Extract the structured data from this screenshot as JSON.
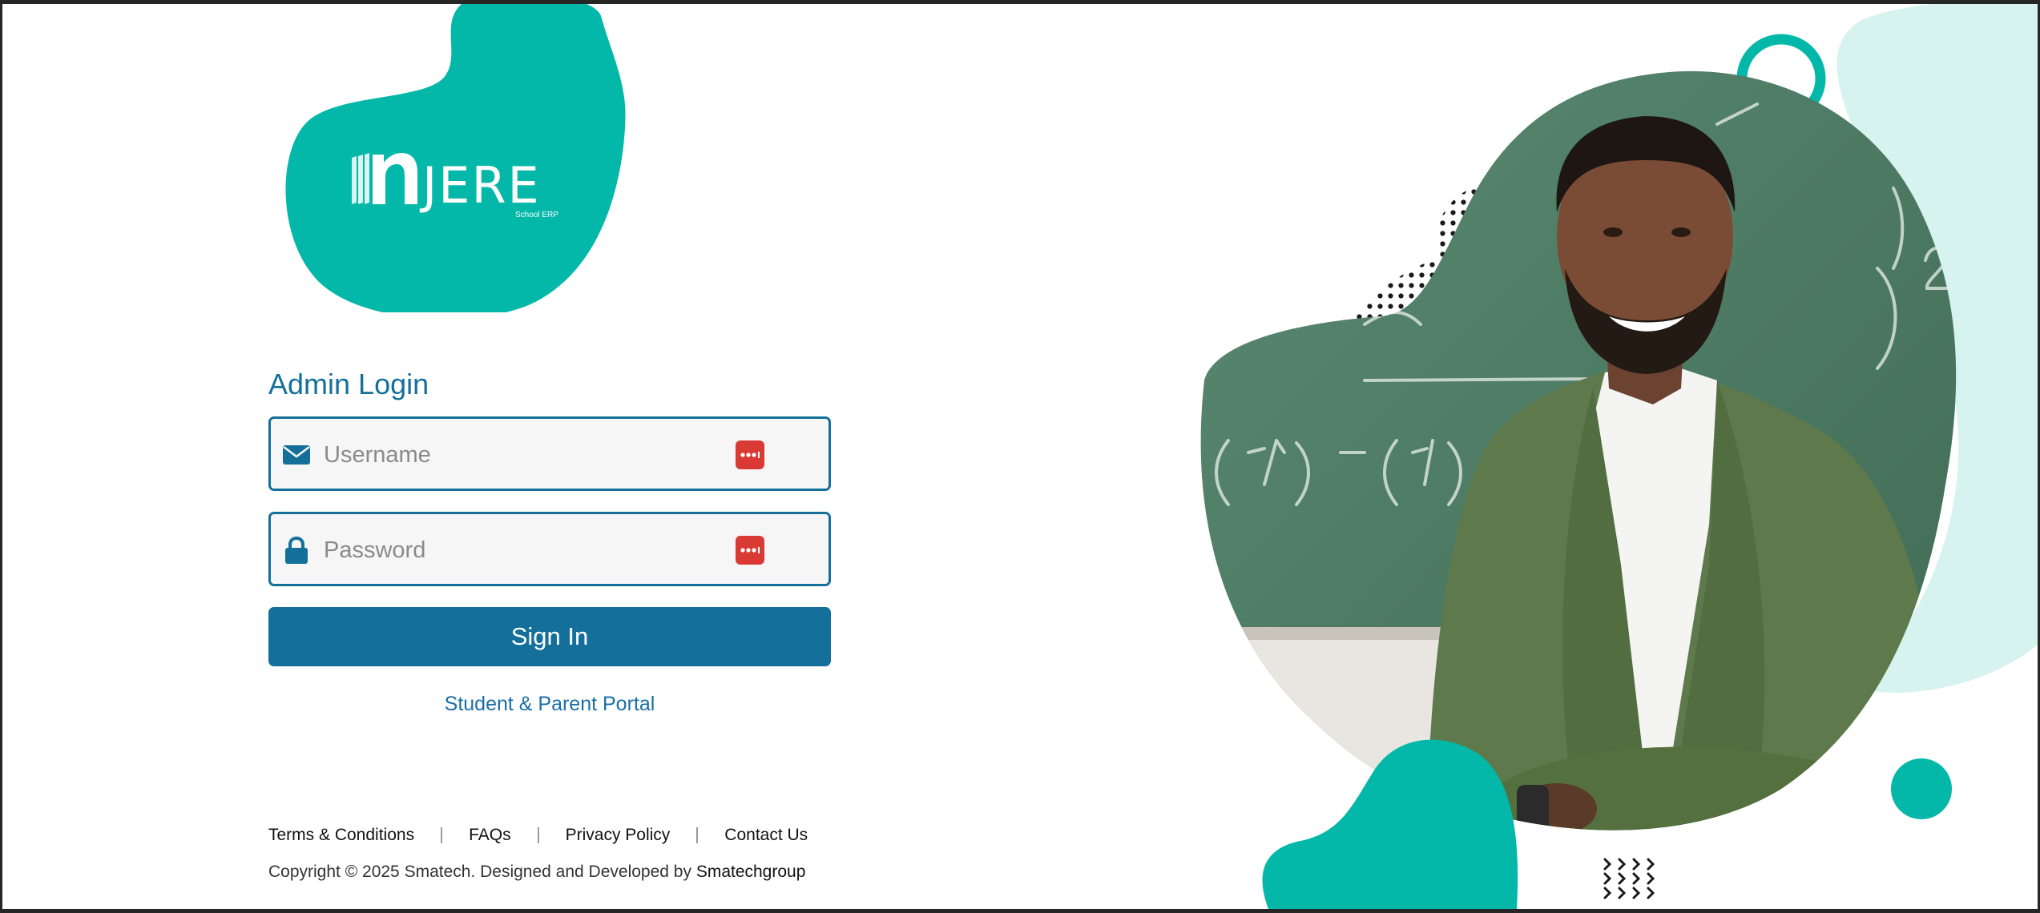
{
  "brand": {
    "logo_text": "JERE",
    "logo_subtext": "School ERP"
  },
  "login": {
    "title": "Admin Login",
    "username_placeholder": "Username",
    "password_placeholder": "Password",
    "sign_in_label": "Sign In",
    "portal_link": "Student & Parent Portal"
  },
  "footer": {
    "links": [
      "Terms & Conditions",
      "FAQs",
      "Privacy Policy",
      "Contact Us"
    ],
    "copyright_prefix": "Copyright © 2025 Smatech. Designed and Developed by ",
    "copyright_brand": "Smatechgroup"
  },
  "colors": {
    "brand_teal": "#04b8a9",
    "primary_blue": "#14709a",
    "light_mint": "#d6f3ef",
    "chalkboard_green": "#4f7a64",
    "password_manager_red": "#da3a34"
  },
  "icons": {
    "username": "envelope-icon",
    "password": "lock-icon",
    "autofill": "password-manager-icon"
  }
}
